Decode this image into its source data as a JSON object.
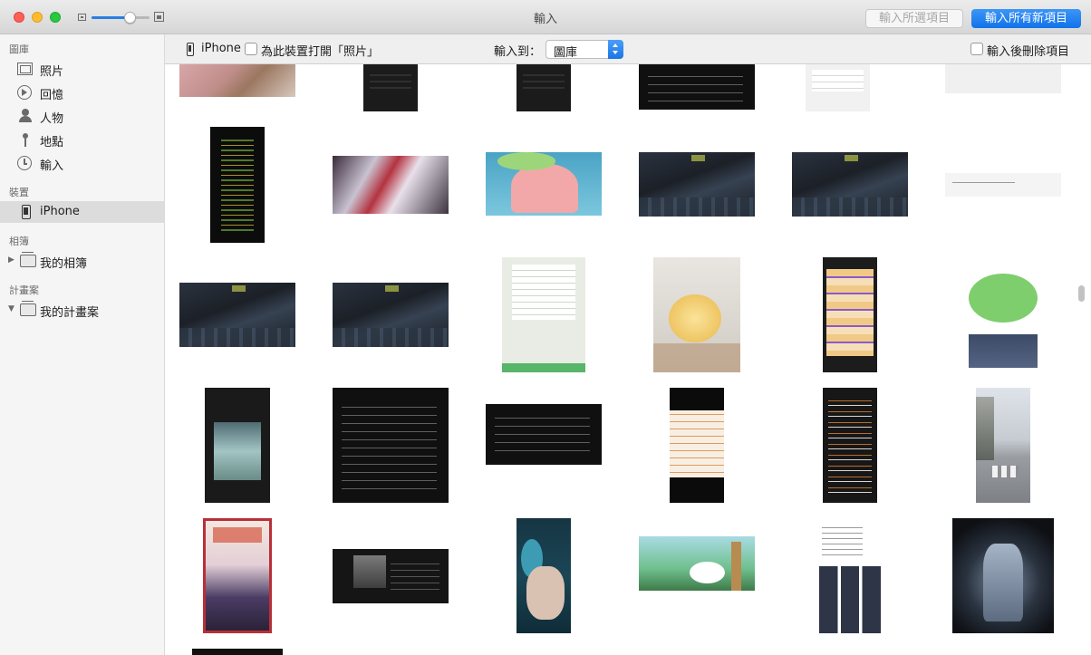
{
  "window": {
    "title": "輸入",
    "buttons": {
      "import_selected": "輸入所選項目",
      "import_all": "輸入所有新項目"
    },
    "zoom_level": 0.66,
    "colors": {
      "accent": "#1173ea",
      "sidebar_bg": "#f5f5f5"
    }
  },
  "sidebar": {
    "library_header": "圖庫",
    "library_items": [
      {
        "label": "照片",
        "icon": "photos-icon"
      },
      {
        "label": "回憶",
        "icon": "memories-icon"
      },
      {
        "label": "人物",
        "icon": "people-icon"
      },
      {
        "label": "地點",
        "icon": "places-icon"
      },
      {
        "label": "輸入",
        "icon": "imports-icon"
      }
    ],
    "devices_header": "裝置",
    "device": {
      "label": "iPhone",
      "icon": "iphone-icon",
      "selected": true
    },
    "albums_header": "相簿",
    "my_albums": "我的相簿",
    "projects_header": "計畫案",
    "my_projects": "我的計畫案"
  },
  "toolbar": {
    "device_name": "iPhone",
    "open_photos_label": "為此裝置打開「照片」",
    "open_photos_checked": false,
    "import_to_label": "輸入到：",
    "import_to_value": "圖庫",
    "delete_after_label": "輸入後刪除項目",
    "delete_after_checked": false
  },
  "thumbnails": [
    {
      "style": "pink-photo",
      "desc": "photo"
    },
    {
      "style": "phone-ui",
      "desc": "screenshot"
    },
    {
      "style": "phone-ui",
      "desc": "screenshot"
    },
    {
      "style": "threads-dark",
      "desc": "screenshot"
    },
    {
      "style": "chat-light",
      "desc": "screenshot"
    },
    {
      "style": "lightgray",
      "desc": "screenshot"
    },
    {
      "style": "greenlist",
      "desc": "screenshot"
    },
    {
      "style": "mecha-red",
      "desc": "photo"
    },
    {
      "style": "patrick",
      "desc": "image"
    },
    {
      "style": "game",
      "desc": "screenshot"
    },
    {
      "style": "game",
      "desc": "screenshot"
    },
    {
      "style": "chat-light2",
      "desc": "screenshot"
    },
    {
      "style": "game",
      "desc": "screenshot"
    },
    {
      "style": "game",
      "desc": "screenshot"
    },
    {
      "style": "line-chat",
      "desc": "screenshot"
    },
    {
      "style": "bread",
      "desc": "photo"
    },
    {
      "style": "chart-phone",
      "desc": "screenshot"
    },
    {
      "style": "dino",
      "desc": "image"
    },
    {
      "style": "tg-phone",
      "desc": "screenshot"
    },
    {
      "style": "threads-dark",
      "desc": "screenshot"
    },
    {
      "style": "threads-dark",
      "desc": "screenshot"
    },
    {
      "style": "doc-phone",
      "desc": "screenshot"
    },
    {
      "style": "orange-list",
      "desc": "screenshot"
    },
    {
      "style": "street",
      "desc": "screenshot"
    },
    {
      "style": "poster",
      "desc": "image"
    },
    {
      "style": "tv-dark",
      "desc": "photo"
    },
    {
      "style": "baby",
      "desc": "screenshot"
    },
    {
      "style": "anime",
      "desc": "image"
    },
    {
      "style": "catalog",
      "desc": "screenshot"
    },
    {
      "style": "mecha-poster",
      "desc": "image"
    },
    {
      "style": "dark",
      "desc": "photo"
    }
  ]
}
